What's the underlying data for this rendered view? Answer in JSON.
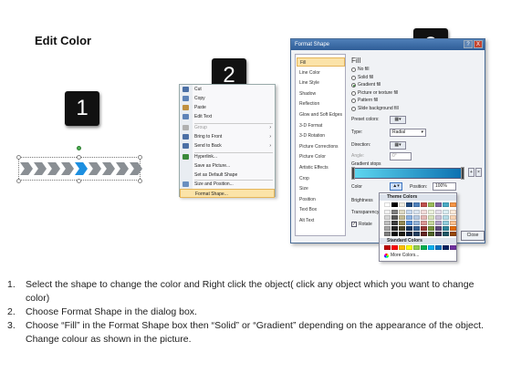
{
  "title": "Edit Color",
  "badges": [
    "1",
    "2",
    "3"
  ],
  "context_menu": {
    "items": [
      {
        "label": "Cut",
        "icon": "scissors-icon",
        "color": "#4b6fa5",
        "disabled": false,
        "arrow": ""
      },
      {
        "label": "Copy",
        "icon": "copy-icon",
        "color": "#5e83b8",
        "disabled": false,
        "arrow": ""
      },
      {
        "label": "Paste",
        "icon": "paste-icon",
        "color": "#c09040",
        "disabled": false,
        "arrow": ""
      },
      {
        "label": "Edit Text",
        "icon": "edit-text-icon",
        "color": "#5e83b8",
        "disabled": false,
        "arrow": ""
      },
      {
        "label": "Group",
        "icon": "group-icon",
        "color": "#b0b0b0",
        "disabled": true,
        "arrow": "›"
      },
      {
        "label": "Bring to Front",
        "icon": "bring-front-icon",
        "color": "#4b6fa5",
        "disabled": false,
        "arrow": "›"
      },
      {
        "label": "Send to Back",
        "icon": "send-back-icon",
        "color": "#4b6fa5",
        "disabled": false,
        "arrow": "›"
      },
      {
        "label": "Hyperlink...",
        "icon": "hyperlink-icon",
        "color": "#3a8a3a",
        "disabled": false,
        "arrow": ""
      },
      {
        "label": "Save as Picture...",
        "icon": "",
        "color": "",
        "disabled": false,
        "arrow": ""
      },
      {
        "label": "Set as Default Shape",
        "icon": "",
        "color": "",
        "disabled": false,
        "arrow": ""
      },
      {
        "label": "Size and Position...",
        "icon": "size-position-icon",
        "color": "#6a8fc0",
        "disabled": false,
        "arrow": ""
      },
      {
        "label": "Format Shape...",
        "icon": "format-shape-icon",
        "color": "#d08a30",
        "disabled": false,
        "arrow": ""
      }
    ]
  },
  "dialog": {
    "title": "Format Shape",
    "help": "?",
    "close_x": "X",
    "nav": [
      "Fill",
      "Line Color",
      "Line Style",
      "Shadow",
      "Reflection",
      "Glow and Soft Edges",
      "3-D Format",
      "3-D Rotation",
      "Picture Corrections",
      "Picture Color",
      "Artistic Effects",
      "Crop",
      "Size",
      "Position",
      "Text Box",
      "Alt Text"
    ],
    "fill_title": "Fill",
    "fill_options": [
      "No fill",
      "Solid fill",
      "Gradient fill",
      "Picture or texture fill",
      "Pattern fill",
      "Slide background fill"
    ],
    "fill_selected_index": 2,
    "preset_colors_label": "Preset colors:",
    "type_label": "Type:",
    "type_value": "Radial",
    "direction_label": "Direction:",
    "angle_label": "Angle:",
    "angle_value": "0°",
    "gradient_stops_label": "Gradient stops",
    "color_label": "Color",
    "position_label": "Position:",
    "position_value": "100%",
    "brightness_label": "Brightness",
    "transparency_label": "Transparency",
    "rotate_label": "Rotate",
    "close_button": "Close",
    "gradient_colors": [
      "#5fd8f0",
      "#0b6fb0"
    ]
  },
  "color_picker": {
    "theme_header": "Theme Colors",
    "standard_header": "Standard Colors",
    "more_colors": "More Colors...",
    "theme_top": [
      "#ffffff",
      "#000000",
      "#eeece1",
      "#1f497d",
      "#4f81bd",
      "#c0504d",
      "#9bbb59",
      "#8064a2",
      "#4bacc6",
      "#f79646"
    ],
    "theme_shades": [
      [
        "#f2f2f2",
        "#7f7f7f",
        "#ddd9c3",
        "#c6d9f0",
        "#dbe5f1",
        "#f2dcdb",
        "#ebf1dd",
        "#e5e0ec",
        "#dbeef3",
        "#fdeada"
      ],
      [
        "#d8d8d8",
        "#595959",
        "#c4bd97",
        "#8db3e2",
        "#b8cce4",
        "#e5b9b7",
        "#d7e3bc",
        "#ccc1d9",
        "#b7dde8",
        "#fbd5b5"
      ],
      [
        "#bfbfbf",
        "#3f3f3f",
        "#938953",
        "#548dd4",
        "#95b3d7",
        "#d99694",
        "#c3d69b",
        "#b2a2c7",
        "#92cddc",
        "#fac08f"
      ],
      [
        "#a5a5a5",
        "#262626",
        "#494429",
        "#17365d",
        "#366092",
        "#953734",
        "#76923c",
        "#5f497a",
        "#31859b",
        "#e36c09"
      ],
      [
        "#7f7f7f",
        "#0c0c0c",
        "#1d1b10",
        "#0f243e",
        "#244061",
        "#632423",
        "#4f6128",
        "#3f3151",
        "#205867",
        "#974806"
      ]
    ],
    "standard": [
      "#c00000",
      "#ff0000",
      "#ffc000",
      "#ffff00",
      "#92d050",
      "#00b050",
      "#00b0f0",
      "#0070c0",
      "#002060",
      "#7030a0"
    ]
  },
  "instructions": [
    {
      "num": "1.",
      "text": "Select the shape to change the color and Right click the object( click any object which you want to change color)"
    },
    {
      "num": "2.",
      "text": "Choose Format Shape in the dialog box."
    },
    {
      "num": "3.",
      "text": "Choose “Fill” in the Format Shape box then “Solid” or “Gradient” depending on the appearance of the object. Change colour as shown in the picture."
    }
  ]
}
